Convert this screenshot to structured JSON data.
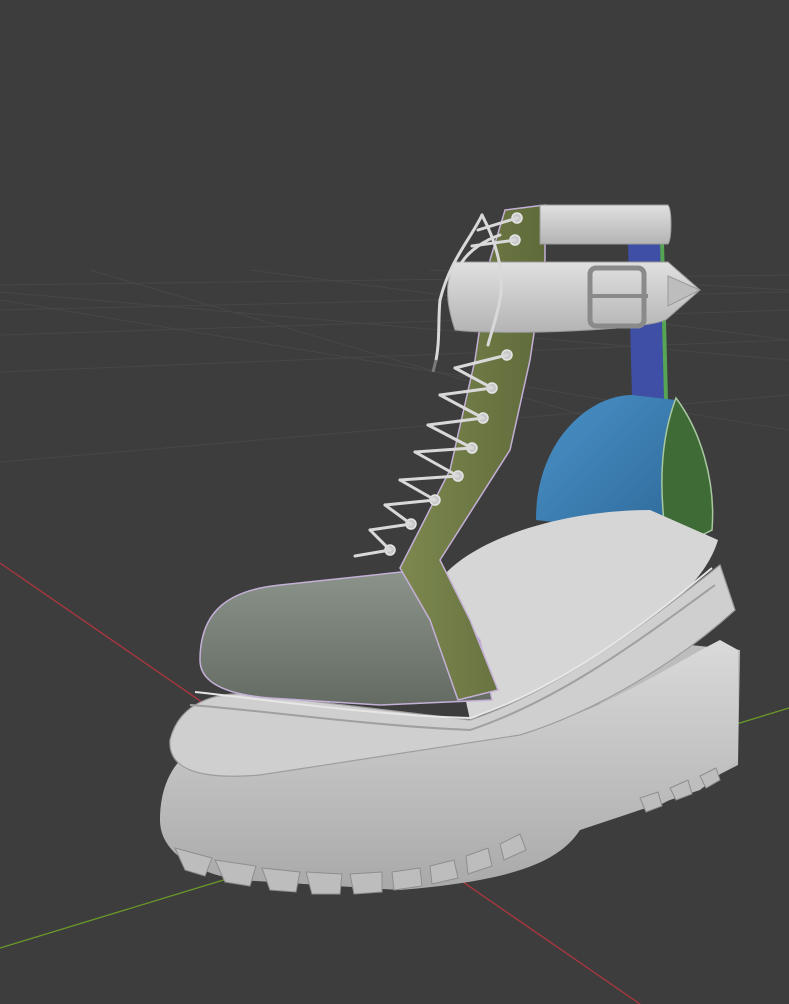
{
  "viewport": {
    "background": "#3d3d3d",
    "grid_color": "#4a4a4a",
    "x_axis_color": "#b0353f",
    "y_axis_color": "#6a9a28"
  },
  "model": {
    "name": "platform-lace-up-boot",
    "materials": {
      "sole": "#c9c9c9",
      "toe_cap": "#7d867c",
      "lace_panel": "#6f7b46",
      "ankle_strap": "#cfcfcf",
      "heel_counter_blue": "#3b7fb5",
      "heel_counter_green": "#3e6b36",
      "back_strap": "#3f4fa6",
      "insole": "#d6d6d6",
      "laces": "#d9d9d9"
    }
  }
}
